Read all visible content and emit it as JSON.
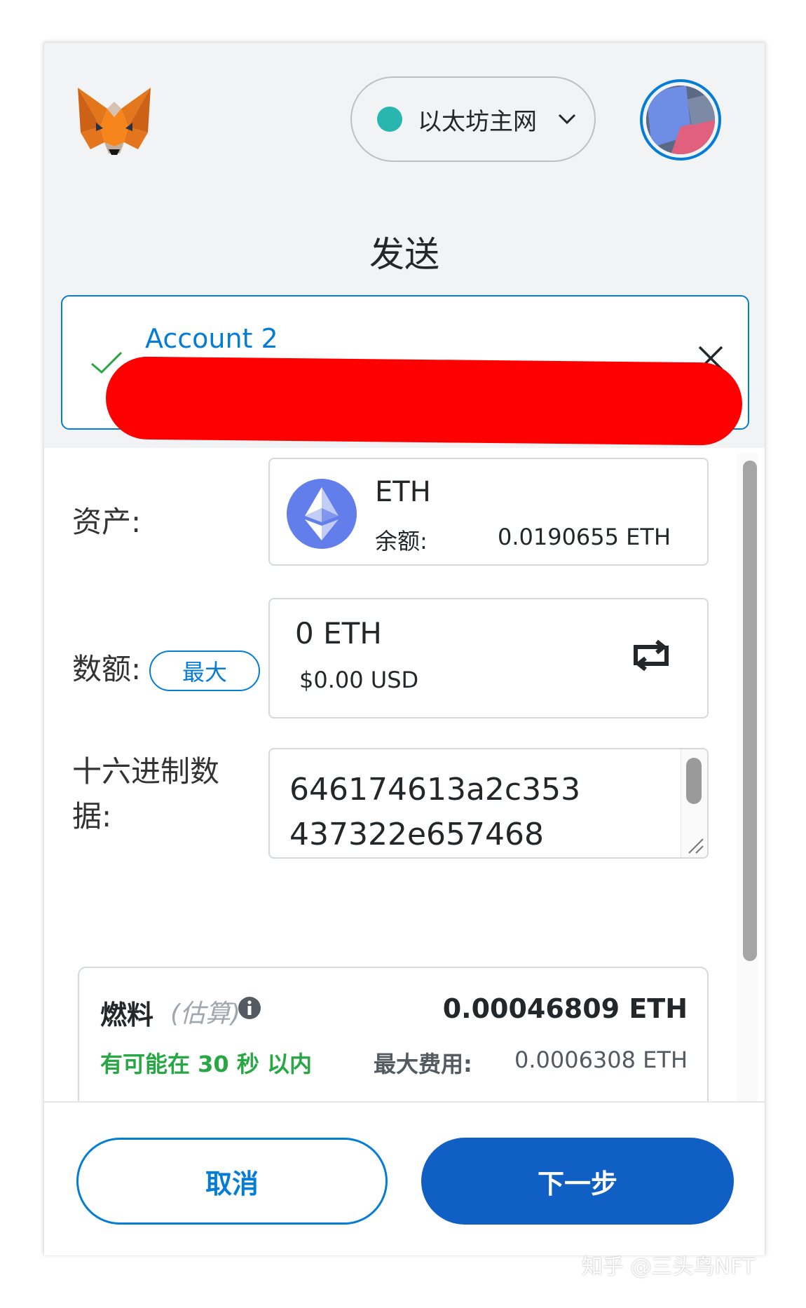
{
  "header": {
    "network_label": "以太坊主网",
    "network_color": "#29b6af"
  },
  "page": {
    "title": "发送"
  },
  "account": {
    "name": "Account 2"
  },
  "asset": {
    "label": "资产:",
    "name": "ETH",
    "balance_label": "余额:",
    "balance_value": "0.0190655 ETH"
  },
  "amount": {
    "label": "数额:",
    "max_label": "最大",
    "value": "0 ETH",
    "usd": "$0.00 USD"
  },
  "hex": {
    "label_line1": "十六进制数",
    "label_line2": "据:",
    "value": "646174613a2c353437322e657468"
  },
  "gas": {
    "title": "燃料",
    "estimate": "(估算)",
    "amount": "0.00046809 ETH",
    "time": "有可能在 30 秒 以内",
    "max_fee_label": "最大费用:",
    "max_fee_value": "0.0006308 ETH"
  },
  "footer": {
    "cancel_label": "取消",
    "next_label": "下一步"
  },
  "watermark": "知乎 @三头鸟NFT",
  "colors": {
    "accent": "#037dd6",
    "primary_button": "#0f5fc4",
    "success": "#28a745",
    "redaction": "#ff0000"
  }
}
